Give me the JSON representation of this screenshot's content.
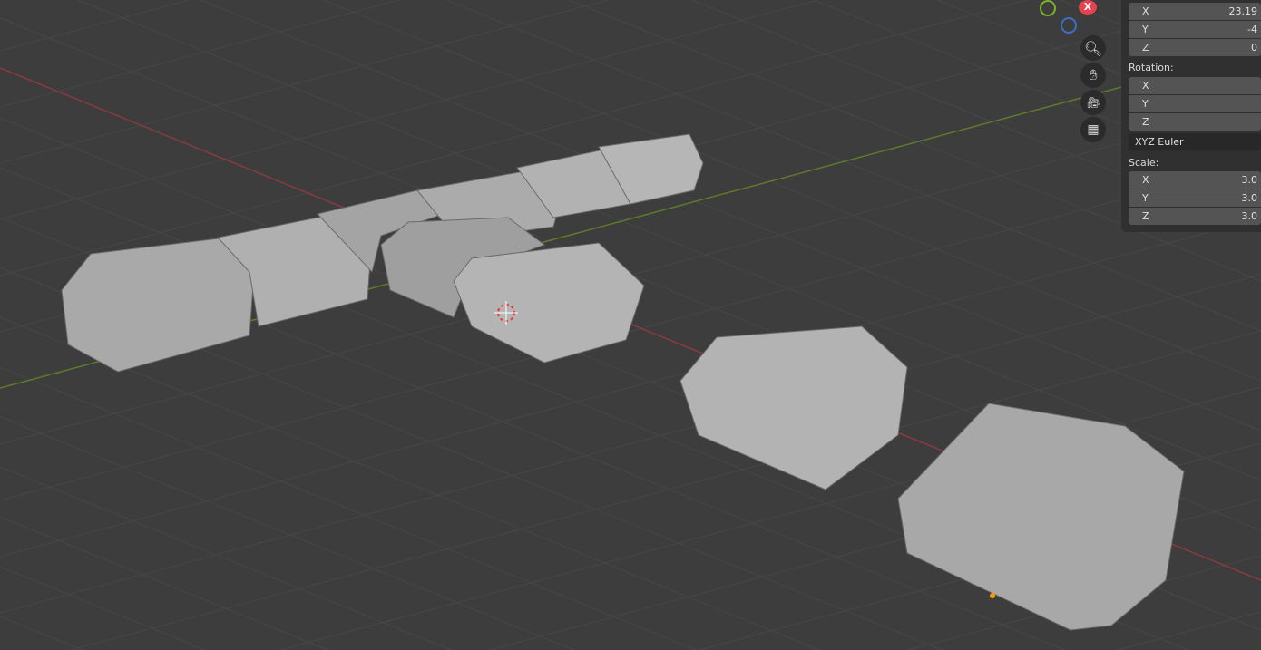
{
  "gizmo": {
    "x_label": "X",
    "colors": {
      "x": "#e8414f",
      "y": "#7db22a",
      "z": "#3a70c8"
    }
  },
  "nav_icons": [
    "zoom-icon",
    "hand-pan-icon",
    "camera-icon",
    "grid-perspective-icon"
  ],
  "panel": {
    "location": [
      {
        "axis": "X",
        "value": "23.19"
      },
      {
        "axis": "Y",
        "value": "-4"
      },
      {
        "axis": "Z",
        "value": "0"
      }
    ],
    "rotation_label": "Rotation:",
    "rotation": [
      {
        "axis": "X",
        "value": ""
      },
      {
        "axis": "Y",
        "value": ""
      },
      {
        "axis": "Z",
        "value": ""
      }
    ],
    "rotation_mode": "XYZ Euler",
    "scale_label": "Scale:",
    "scale": [
      {
        "axis": "X",
        "value": "3.0"
      },
      {
        "axis": "Y",
        "value": "3.0"
      },
      {
        "axis": "Z",
        "value": "3.0"
      }
    ]
  }
}
